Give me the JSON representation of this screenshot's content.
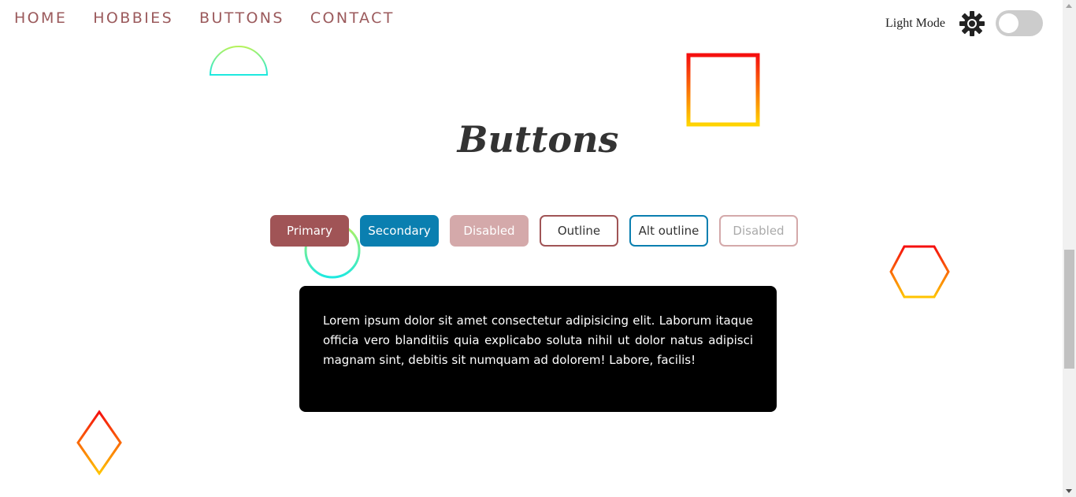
{
  "nav": {
    "items": [
      {
        "label": "HOME"
      },
      {
        "label": "HOBBIES"
      },
      {
        "label": "BUTTONS"
      },
      {
        "label": "CONTACT"
      }
    ]
  },
  "theme": {
    "label": "Light Mode",
    "icon": "gear-icon",
    "toggle_on": false
  },
  "main": {
    "title": "Buttons",
    "buttons": [
      {
        "label": "Primary",
        "style": "primary"
      },
      {
        "label": "Secondary",
        "style": "secondary"
      },
      {
        "label": "Disabled",
        "style": "disabled"
      },
      {
        "label": "Outline",
        "style": "outline"
      },
      {
        "label": "Alt outline",
        "style": "alt-outline"
      },
      {
        "label": "Disabled",
        "style": "disabled-outline"
      }
    ],
    "card_text": "Lorem ipsum dolor sit amet consectetur adipisicing elit. Laborum itaque officia vero blanditiis quia explicabo soluta nihil ut dolor natus adipisci magnam sint, debitis sit numquam ad dolorem! Labore, facilis!"
  },
  "colors": {
    "nav_text": "#9b5a5c",
    "primary": "#a05456",
    "secondary": "#0a7fb0",
    "disabled": "#d4a9aa",
    "card_bg": "#000000"
  }
}
